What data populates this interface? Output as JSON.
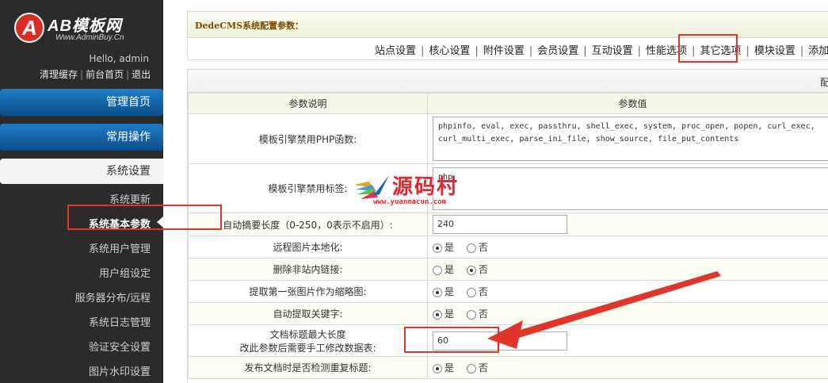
{
  "sidebar": {
    "logo_mark": "A",
    "brand": "AB模板网",
    "brand_url": "Www.AdminBuy.Cn",
    "hello": "Hello, admin",
    "top_links": [
      "清理缓存",
      "前台首页",
      "退出"
    ],
    "nav": {
      "home": "管理首页",
      "common": "常用操作",
      "system": "系统设置"
    },
    "sub_items": [
      "系统更新",
      "系统基本参数",
      "系统用户管理",
      "用户组设定",
      "服务器分布/远程",
      "系统日志管理",
      "验证安全设置",
      "图片水印设置"
    ],
    "active_sub": "系统基本参数"
  },
  "header": {
    "title": "DedeCMS系统配置参数："
  },
  "tabs": [
    "站点设置",
    "核心设置",
    "附件设置",
    "会员设置",
    "互动设置",
    "性能选项",
    "其它选项",
    "模块设置",
    "添加新变"
  ],
  "table": {
    "title_row_text": "配",
    "col_desc": "参数说明",
    "col_value": "参数值",
    "rows": {
      "php_funcs": {
        "label": "模板引擎禁用PHP函数:",
        "value": "phpinfo, eval, exec, passthru, shell_exec, system, proc_open, popen, curl_exec, curl_multi_exec, parse_ini_file, show_source, file_put_contents"
      },
      "tags": {
        "label": "模板引擎禁用标签:",
        "value": "php"
      },
      "summary_len": {
        "label": "自动摘要长度（0-250，0表示不启用）:",
        "value": "240"
      },
      "remote_img": {
        "label": "远程图片本地化:",
        "yes": "是",
        "no": "否",
        "selected": "yes"
      },
      "del_links": {
        "label": "删除非站内链接:",
        "yes": "是",
        "no": "否",
        "selected": "no"
      },
      "first_img": {
        "label": "提取第一张图片作为缩略图:",
        "yes": "是",
        "no": "否",
        "selected": "yes"
      },
      "auto_kw": {
        "label": "自动提取关键字:",
        "yes": "是",
        "no": "否",
        "selected": "yes"
      },
      "title_max": {
        "label_1": "文档标题最大长度",
        "label_2": "改此参数后需要手工修改数据表:",
        "value": "60"
      },
      "dup_check": {
        "label": "发布文档时是否检测重复标题:",
        "yes": "是",
        "no": "否",
        "selected": "yes"
      }
    }
  },
  "watermark": {
    "text": "源码村",
    "url": "www.yuanmacun.com"
  },
  "colors": {
    "sidebar_bg": "#2b2b2b",
    "nav_blue": "#0b4f8c",
    "highlight_red": "#e1352b",
    "header_brown": "#7a4a00"
  }
}
